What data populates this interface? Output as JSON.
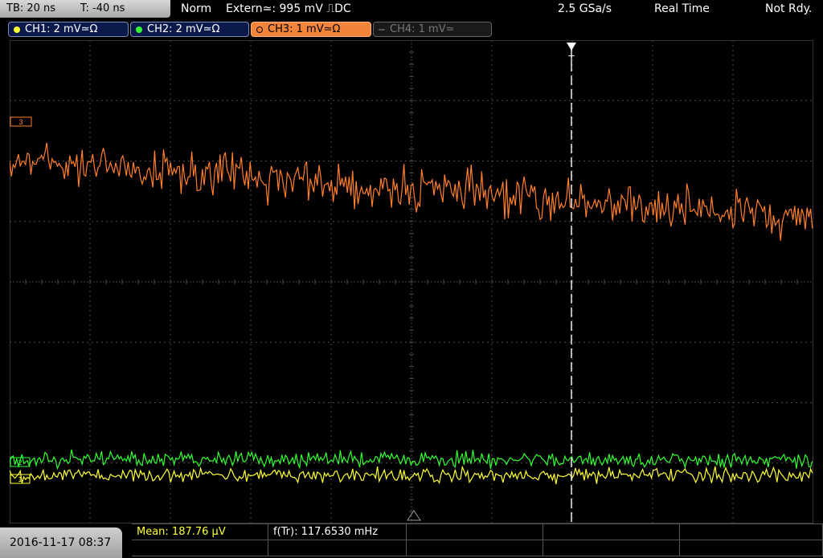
{
  "topbar": {
    "timebase": "TB: 20 ns",
    "trigger_time": "T: -40 ns",
    "trigger_mode": "Norm",
    "trigger_source": "Extern≃: 995 mV ⎍DC",
    "sample_rate": "2.5 GSa/s",
    "acquisition_mode": "Real Time",
    "status": "Not Rdy."
  },
  "channels": [
    {
      "label": "CH1: 2 mV≃Ω",
      "color": "#ffff33"
    },
    {
      "label": "CH2: 2 mV≃Ω",
      "color": "#33ff33"
    },
    {
      "label": "CH3: 1 mV≃Ω",
      "color": "#ff7f2a"
    },
    {
      "label": "CH4: 1 mV≃",
      "color": "#666666"
    }
  ],
  "markers": {
    "ch3": "3",
    "ch2": "2",
    "ch1": "1",
    "trigger": "T"
  },
  "footer": {
    "datetime": "2016-11-17 08:37",
    "mean": "Mean: 187.76 µV",
    "frequency": "f(Tr): 117.6530 mHz"
  },
  "colors": {
    "background": "#000000",
    "grid": "#555555",
    "ch1": "#ffff33",
    "ch2": "#33ff33",
    "ch3": "#ff7f2a",
    "trigger_line": "#ffffff",
    "mean_text": "#ffff33"
  }
}
